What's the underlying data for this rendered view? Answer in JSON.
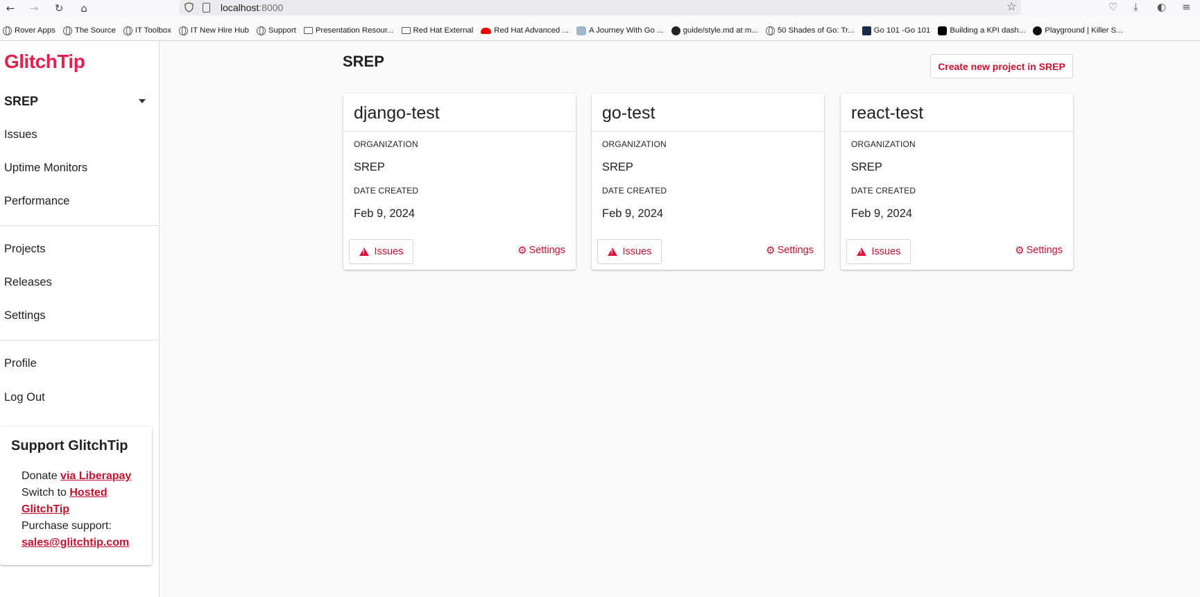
{
  "browser": {
    "url_host": "localhost",
    "url_port": ":8000",
    "bookmarks": [
      {
        "label": "Rover Apps",
        "icon": "globe-icon"
      },
      {
        "label": "The Source",
        "icon": "globe-icon"
      },
      {
        "label": "IT Toolbox",
        "icon": "globe-icon"
      },
      {
        "label": "IT New Hire Hub",
        "icon": "globe-icon"
      },
      {
        "label": "Support",
        "icon": "globe-icon"
      },
      {
        "label": "Presentation Resour...",
        "icon": "folder-icon"
      },
      {
        "label": "Red Hat External",
        "icon": "folder-icon"
      },
      {
        "label": "Red Hat Advanced ...",
        "icon": "redhat-icon"
      },
      {
        "label": "A Journey With Go ...",
        "icon": "gopher-icon"
      },
      {
        "label": "guide/style.md at m...",
        "icon": "github-icon"
      },
      {
        "label": "50 Shades of Go: Tr...",
        "icon": "globe-icon"
      },
      {
        "label": "Go 101 -Go 101",
        "icon": "go101-icon"
      },
      {
        "label": "Building a KPI dash...",
        "icon": "medium-icon"
      },
      {
        "label": "Playground | Killer S...",
        "icon": "killercoda-icon"
      }
    ]
  },
  "sidebar": {
    "logo": "GlitchTip",
    "org_name": "SREP",
    "nav_primary": [
      "Issues",
      "Uptime Monitors",
      "Performance"
    ],
    "nav_secondary": [
      "Projects",
      "Releases",
      "Settings"
    ],
    "nav_account": [
      "Profile",
      "Log Out"
    ],
    "support": {
      "title": "Support GlitchTip",
      "donate_prefix": "Donate ",
      "donate_link": "via Liberapay",
      "switch_prefix": "Switch to ",
      "switch_link": "Hosted GlitchTip",
      "purchase_label": "Purchase support:",
      "email": "sales@glitchtip.com"
    }
  },
  "main": {
    "title": "SREP",
    "create_button": "Create new project in SREP",
    "org_label": "ORGANIZATION",
    "date_label": "DATE CREATED",
    "issues_label": "Issues",
    "settings_label": "Settings",
    "projects": [
      {
        "name": "django-test",
        "organization": "SREP",
        "date_created": "Feb 9, 2024"
      },
      {
        "name": "go-test",
        "organization": "SREP",
        "date_created": "Feb 9, 2024"
      },
      {
        "name": "react-test",
        "organization": "SREP",
        "date_created": "Feb 9, 2024"
      }
    ]
  },
  "colors": {
    "brand": "#e91e4c",
    "accent": "#c8102e"
  }
}
